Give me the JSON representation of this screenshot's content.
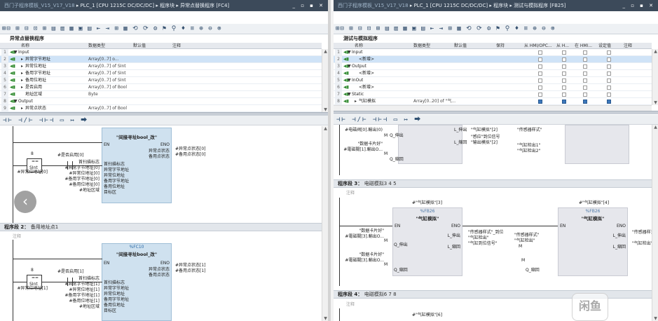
{
  "left": {
    "titlebar": {
      "prefix": "西门子程序模板_V15_V17_V18",
      "path": "PLC_1 [CPU 1215C DC/DC/DC] ▸ 程序块 ▸ 异常点替换程序 [FC4]",
      "controls": "_ ▫ ▪ ✕"
    },
    "toolbar_glyphs": "⊞⊟ ⊞ ⊟ ⊡ ⊞ ▤ ▥ ▦ ▣ ▤ ⇤ ⇥ ⊞ ▦ ⟲ ⟳ ⚙ ⚑ ⚲ ♦ ≡ ⊕ ⊖ ⊗",
    "block_title": "异常点替换程序",
    "columns": [
      "名称",
      "数据类型",
      "默认值",
      "注释"
    ],
    "rows": [
      {
        "n": "1",
        "arrow": "▼",
        "name": "Input",
        "type": "",
        "indent": 0
      },
      {
        "n": "2",
        "arrow": "▸",
        "name": "异常字节地址",
        "type": "Array[0..7] o...",
        "indent": 1,
        "sel": true
      },
      {
        "n": "3",
        "arrow": "▸",
        "name": "异常位地址",
        "type": "Array[0..7] of SInt",
        "indent": 1
      },
      {
        "n": "4",
        "arrow": "▸",
        "name": "备用字节地址",
        "type": "Array[0..7] of SInt",
        "indent": 1
      },
      {
        "n": "5",
        "arrow": "▸",
        "name": "备用位地址",
        "type": "Array[0..7] of SInt",
        "indent": 1
      },
      {
        "n": "6",
        "arrow": "▸",
        "name": "是否启用",
        "type": "Array[0..7] of Bool",
        "indent": 1
      },
      {
        "n": "7",
        "arrow": "",
        "name": "地址区域",
        "type": "Byte",
        "indent": 1
      },
      {
        "n": "8",
        "arrow": "▼",
        "name": "Output",
        "type": "",
        "indent": 0
      },
      {
        "n": "9",
        "arrow": "▸",
        "name": "异常点状态",
        "type": "Array[0..7] of Bool",
        "indent": 1
      }
    ],
    "ladder_tools": "⊣⊢ ⊣/⊢ ⊣⊢⊣ ▭ ↦ ⮕",
    "net1": {
      "fc_num": "%FC10",
      "fc_title": "\"间接寻址bool_改\"",
      "en": "EN",
      "eno": "ENO",
      "cmp_top": "8",
      "cmp_op": "==",
      "cmp_type": "SInt",
      "cmp_var": "#异常位地址[0]",
      "contact_var": "#是否启用[0]",
      "inputs": [
        "首扫描标志",
        "#异常字节地址[0]",
        "#异常位地址[0]",
        "#备用字节地址[0]",
        "#备用位地址[0]",
        "#地址区域"
      ],
      "input_pins": [
        "首扫描标志",
        "异常字节地址",
        "异常位地址",
        "备用字节地址",
        "备用位地址",
        "目标区"
      ],
      "outputs": [
        "异常点状态",
        "备用点状态"
      ],
      "out_vars": [
        "#异常点状态[0]",
        "#备用点状态[0]"
      ]
    },
    "net2": {
      "label": "程序段 2：",
      "title": "备用地址点1",
      "comment": "注释",
      "fc_num": "%FC10",
      "fc_title": "\"间接寻址bool_改\"",
      "en": "EN",
      "eno": "ENO",
      "cmp_top": "8",
      "cmp_op": "==",
      "cmp_type": "SInt",
      "cmp_var": "#异常位地址[1]",
      "contact_var": "#是否启用[1]",
      "inputs": [
        "首扫描标志",
        "#异常字节地址[1]",
        "#异常位地址[1]",
        "#备用字节地址[1]",
        "#备用位地址[1]",
        "#地址区域"
      ],
      "input_pins": [
        "首扫描标志",
        "异常字节地址",
        "异常位地址",
        "备用字节地址",
        "备用位地址",
        "目标区"
      ],
      "outputs": [
        "异常点状态",
        "备用点状态"
      ],
      "out_vars": [
        "#异常点状态[1]",
        "#备用点状态[1]"
      ]
    },
    "back_glyph": "‹"
  },
  "right": {
    "titlebar": {
      "prefix": "西门子程序模板_V15_V17_V18",
      "path": "PLC_1 [CPU 1215C DC/DC/DC] ▸ 程序块 ▸ 测试与模拟程序 [FB25]",
      "controls": "_ ▫ ▪ ✕"
    },
    "toolbar_glyphs": "⊞⊟ ⊞ ⊟ ⊡ ⊞ ▤ ▥ ▦ ▣ ▤ ⇤ ⇥ ⊞ ▦ ⟲ ⟳ ⚙ ⚑ ⚲ ♦ ≡ ⊕ ⊖ ⊗",
    "block_title": "测试与模拟程序",
    "columns": [
      "名称",
      "数据类型",
      "默认值",
      "保持",
      "从 HMI/OPC...",
      "从 H...",
      "在 HMI...",
      "设定值",
      "注释"
    ],
    "rows": [
      {
        "n": "1",
        "arrow": "▼",
        "name": "Input",
        "type": "",
        "indent": 0,
        "checks": [
          false,
          false,
          false,
          false
        ]
      },
      {
        "n": "2",
        "arrow": "",
        "name": "<新增>",
        "type": "",
        "indent": 1,
        "sel": true,
        "checks": [
          false,
          false,
          false,
          false
        ]
      },
      {
        "n": "3",
        "arrow": "▼",
        "name": "Output",
        "type": "",
        "indent": 0,
        "checks": [
          false,
          false,
          false,
          false
        ]
      },
      {
        "n": "4",
        "arrow": "",
        "name": "<新增>",
        "type": "",
        "indent": 1,
        "checks": [
          false,
          false,
          false,
          false
        ]
      },
      {
        "n": "5",
        "arrow": "▼",
        "name": "InOut",
        "type": "",
        "indent": 0,
        "checks": [
          false,
          false,
          false,
          false
        ]
      },
      {
        "n": "6",
        "arrow": "",
        "name": "<新增>",
        "type": "",
        "indent": 1,
        "checks": [
          false,
          false,
          false,
          false
        ]
      },
      {
        "n": "7",
        "arrow": "▼",
        "name": "Static",
        "type": "",
        "indent": 0,
        "checks": [
          false,
          false,
          false,
          false
        ]
      },
      {
        "n": "8",
        "arrow": "▸",
        "name": "气缸模拟",
        "type": "Array[0..20] of \"气...",
        "indent": 1,
        "checks": [
          true,
          true,
          true,
          true
        ]
      }
    ],
    "ladder_tools": "⊣⊢ ⊣/⊢ ⊣⊢⊣ ▭ ↦ ⮕",
    "top_frag": {
      "left_lines": [
        "#电磁阀[0].輸出(0)",
        "\"数据卡片好\"",
        "\"最后调用出[0]\"",
        "#電磁閥[1].輸出O..."
      ],
      "pins_l": [
        "M",
        "Q_伸出",
        "M",
        "Q_縮回"
      ],
      "pins_r": [
        "L_伸出",
        "L_縮回"
      ],
      "right_vars": [
        "\"传感器样式\"",
        "\"气缸检出1\"",
        "\"气缸检出2\""
      ],
      "mid_lines": [
        "\"气缸模拟\"[2]",
        "\"感应\"到位信号",
        "\"输出模拟\"[2]"
      ]
    },
    "net3": {
      "label": "程序段 3：",
      "title": "电磁模拟3 4 5",
      "comment": "注释",
      "blocks": [
        {
          "inst": "#\"气缸模拟\"[3]",
          "num": "%FB26",
          "title": "\"气缸模拟\""
        },
        {
          "inst": "#\"气缸模拟\"[4]",
          "num": "%FB26",
          "title": "\"气缸模拟\""
        }
      ],
      "en": "EN",
      "eno": "ENO",
      "lefts": [
        "\"数据卡片好\"",
        "#電磁閥[3].輸出O...",
        "\"数据卡片好\"",
        "#電磁閥[3].輸出O..."
      ],
      "pins": [
        "M",
        "Q_伸出",
        "M",
        "Q_縮回"
      ],
      "out_pins": [
        "L_伸出",
        "L_縮回"
      ],
      "mid_vars": [
        "\"传感器样式\"_到位",
        "\"气缸检出\"",
        "\"气缸到位信号\""
      ],
      "right_vars": [
        "\"传感器样式\"",
        "\"气缸检出\""
      ]
    },
    "net4": {
      "label": "程序段 4：",
      "title": "电磁模拟6 7 8",
      "comment": "注释",
      "inst": "#\"气缸模拟\"[6]"
    },
    "watermark": "闲鱼"
  }
}
